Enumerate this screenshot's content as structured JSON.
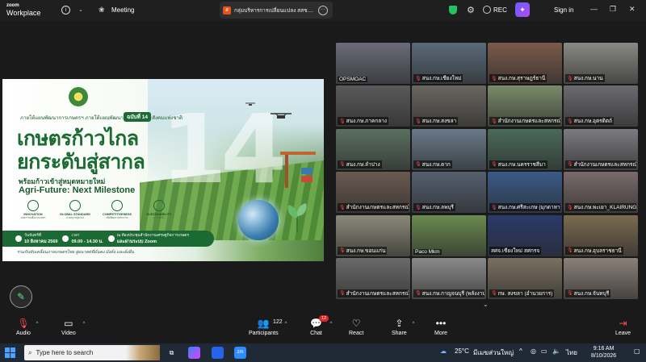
{
  "titlebar": {
    "brand_line1": "zoom",
    "brand_line2": "Workplace",
    "meeting_label": "Meeting",
    "tab_label": "กลุ่มบริหารการเปลี่ยนแปลง สสช....",
    "rec_label": "REC",
    "signin_label": "Sign in"
  },
  "poster": {
    "subtitle": "ภายใต้แผนพัฒนาการเกษตรฯ ภายใต้แผนพัฒนาเศรษฐกิจและสังคมแห่งชาติ",
    "edition": "ฉบับที่ 14",
    "title_line1": "เกษตรก้าวไกล",
    "title_line2": "ยกระดับสู่สากล",
    "tagline": "พร้อมก้าวเข้าสู่หมุดหมายใหม่",
    "agri": "Agri-Future: Next Milestone",
    "big_number": "14",
    "pillars": [
      {
        "title": "INNOVATION",
        "desc": "นวัตกรรมเพื่อการเกษตร"
      },
      {
        "title": "GLOBAL STANDARD",
        "desc": "มาตรฐานสู่สากล"
      },
      {
        "title": "COMPETITIVENESS",
        "desc": "เพิ่มขีดความสามารถ"
      },
      {
        "title": "SUSTAINABILITY",
        "desc": "ความยั่งยืน"
      }
    ],
    "date_label": "วันจันทร์ที่",
    "date_value": "10 สิงหาคม 2569",
    "time_label": "เวลา",
    "time_value": "09.00 - 14.30 น.",
    "venue_label": "ณ ห้องประชุมสำนักงานเศรษฐกิจการเกษตร",
    "venue_value": "และผ่านระบบ Zoom",
    "footer": "ร่วมกันขับเคลื่อนภาคเกษตรไทย สู่อนาคตที่มั่นคง มั่งคั่ง และยั่งยืน"
  },
  "gallery": {
    "tiles": [
      {
        "name": "OPSMOAC",
        "muted": false,
        "active": true,
        "bg": "#6b6b7a"
      },
      {
        "name": "สนง.กษ.เชียงใหม่",
        "muted": true,
        "active": false,
        "bg": "#5a6a7a"
      },
      {
        "name": "สนง.กษ.สุราษฎร์ธานี",
        "muted": true,
        "active": false,
        "bg": "#7a5a4a"
      },
      {
        "name": "สนง.กษ.นาน",
        "muted": true,
        "active": false,
        "bg": "#8a8a84"
      },
      {
        "name": "สนง.กษ.ภาคกลาง",
        "muted": true,
        "active": false,
        "bg": "#5a5a5a"
      },
      {
        "name": "สนง.กษ.สงขลา",
        "muted": true,
        "active": false,
        "bg": "#6a6660"
      },
      {
        "name": "สำนักงานเกษตรและสหกรณ์",
        "muted": true,
        "active": false,
        "bg": "#7a8a6a"
      },
      {
        "name": "สนง.กษ.อุตรดิตถ์",
        "muted": true,
        "active": false,
        "bg": "#6a6a70"
      },
      {
        "name": "สนง.กษ.ลำปาง",
        "muted": true,
        "active": false,
        "bg": "#5a7060"
      },
      {
        "name": "สนง.กษ.ตาก",
        "muted": true,
        "active": false,
        "bg": "#6a7a8a"
      },
      {
        "name": "สนง.กษ.นครราชสีมา",
        "muted": true,
        "active": false,
        "bg": "#4a6a5a"
      },
      {
        "name": "สำนักงานเกษตรและสหกรณ์",
        "muted": true,
        "active": false,
        "bg": "#7a7a80"
      },
      {
        "name": "สำนักงานเกษตรและสหกรณ์",
        "muted": true,
        "active": false,
        "bg": "#6a5a50"
      },
      {
        "name": "สนง.กษ.ลพบุรี",
        "muted": true,
        "active": false,
        "bg": "#556070"
      },
      {
        "name": "สนง.กษ.ศรีสะเกษ (มุกดาหาร)",
        "muted": true,
        "active": false,
        "bg": "#3a5a8a"
      },
      {
        "name": "สนง.กษ.พะเยา_KLAIRUNG",
        "muted": true,
        "active": false,
        "bg": "#7a6a6a"
      },
      {
        "name": "สนง.กษ.ขอนแก่น",
        "muted": true,
        "active": false,
        "bg": "#8a8a7a"
      },
      {
        "name": "Paco Mkm",
        "muted": false,
        "active": false,
        "bg": "#6a8a50"
      },
      {
        "name": "สศจ.เชียงใหม่ สศกรจ",
        "muted": false,
        "active": false,
        "bg": "#2a3a6a"
      },
      {
        "name": "สนง.กษ.อุบลราชธานี",
        "muted": true,
        "active": false,
        "bg": "#7a6a50"
      },
      {
        "name": "สำนักงานเกษตรและสหกรณ์",
        "muted": true,
        "active": false,
        "bg": "#6a6a6a"
      },
      {
        "name": "สนง.กษ.กาญจนบุรี (พลังงาน)",
        "muted": true,
        "active": false,
        "bg": "#8a8a8a"
      },
      {
        "name": "กษ. สงขลา (อำนวยการ)",
        "muted": true,
        "active": false,
        "bg": "#7a7060"
      },
      {
        "name": "สนง.กษ.จันทบุรี",
        "muted": true,
        "active": false,
        "bg": "#8a8078"
      }
    ],
    "more_label": "⌄"
  },
  "toolbar": {
    "audio": "Audio",
    "video": "Video",
    "participants": "Participants",
    "participants_count": "122",
    "chat": "Chat",
    "chat_badge": "12",
    "react": "React",
    "share": "Share",
    "more": "More",
    "leave": "Leave"
  },
  "taskbar": {
    "search_placeholder": "Type here to search",
    "weather": "25°C",
    "weather_desc": "มีเมฆส่วนใหญ่",
    "lang": "ไทย",
    "time": "9:16 AM",
    "date": "8/10/2026"
  },
  "colors": {
    "accent_green": "#2ecc71",
    "leave_red": "#e02424",
    "poster_green": "#1a6b32"
  }
}
